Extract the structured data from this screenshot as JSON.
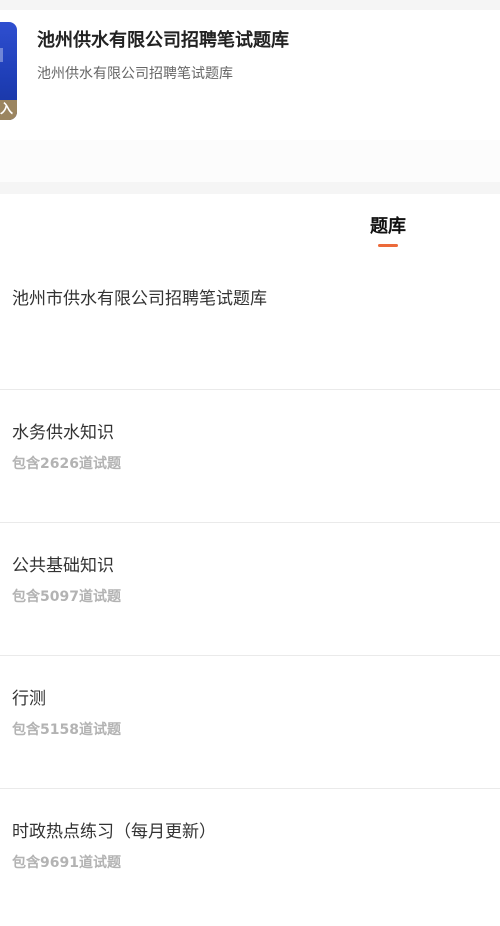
{
  "header": {
    "cover_band_text": "入",
    "title": "池州供水有限公司招聘笔试题库",
    "subtitle": "池州供水有限公司招聘笔试题库"
  },
  "tabs": [
    {
      "label": "题库",
      "active": true
    }
  ],
  "bank_title": "池州市供水有限公司招聘笔试题库",
  "sections": [
    {
      "name": "水务供水知识",
      "count_text": "包含2626道试题"
    },
    {
      "name": "公共基础知识",
      "count_text": "包含5097道试题"
    },
    {
      "name": "行测",
      "count_text": "包含5158道试题"
    },
    {
      "name": "时政热点练习（每月更新）",
      "count_text": "包含9691道试题"
    }
  ],
  "colors": {
    "accent": "#ec6a3a",
    "cover_blue": "#2f4fd0",
    "muted_text": "#b3b3b3"
  }
}
